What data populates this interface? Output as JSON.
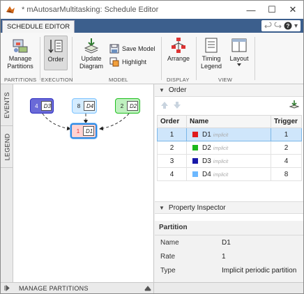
{
  "window": {
    "title": "* mAutosarMultitasking: Schedule Editor",
    "minimize": "—",
    "maximize": "☐",
    "close": "✕"
  },
  "ribbon": {
    "tab": "SCHEDULE EDITOR",
    "quick_access": {
      "help": "?",
      "more": "▾"
    },
    "buttons": {
      "manage_partitions": "Manage\nPartitions",
      "order": "Order",
      "update_diagram": "Update\nDiagram",
      "save_model": "Save Model",
      "highlight": "Highlight",
      "arrange": "Arrange",
      "timing_legend": "Timing\nLegend",
      "layout": "Layout"
    },
    "groups": {
      "partitions": "PARTITIONS",
      "execution": "EXECUTION",
      "model": "MODEL",
      "display": "DISPLAY",
      "view": "VIEW"
    }
  },
  "side_tabs": {
    "events": "EVENTS",
    "legend": "LEGEND"
  },
  "canvas": {
    "blocks": [
      {
        "num": "4",
        "name": "D3",
        "color": "#2b2bbf"
      },
      {
        "num": "8",
        "name": "D4",
        "color": "#7cc3ff"
      },
      {
        "num": "2",
        "name": "D2",
        "color": "#1fbf1f"
      },
      {
        "num": "1",
        "name": "D1",
        "color": "#e03030"
      }
    ]
  },
  "bottom": {
    "manage_partitions": "MANAGE PARTITIONS"
  },
  "order_panel": {
    "title": "Order",
    "columns": [
      "Order",
      "Name",
      "Trigger"
    ],
    "rows": [
      {
        "order": "1",
        "name": "D1",
        "tag": "implicit",
        "trigger": "1",
        "color": "#e01b1b",
        "selected": true
      },
      {
        "order": "2",
        "name": "D2",
        "tag": "implicit",
        "trigger": "2",
        "color": "#1cb81c",
        "selected": false
      },
      {
        "order": "3",
        "name": "D3",
        "tag": "implicit",
        "trigger": "4",
        "color": "#1818a8",
        "selected": false
      },
      {
        "order": "4",
        "name": "D4",
        "tag": "implicit",
        "trigger": "8",
        "color": "#6cb8ff",
        "selected": false
      }
    ]
  },
  "property_inspector": {
    "title": "Property Inspector",
    "section": "Partition",
    "rows": [
      {
        "label": "Name",
        "value": "D1"
      },
      {
        "label": "Rate",
        "value": "1"
      },
      {
        "label": "Type",
        "value": "Implicit periodic partition"
      }
    ]
  }
}
